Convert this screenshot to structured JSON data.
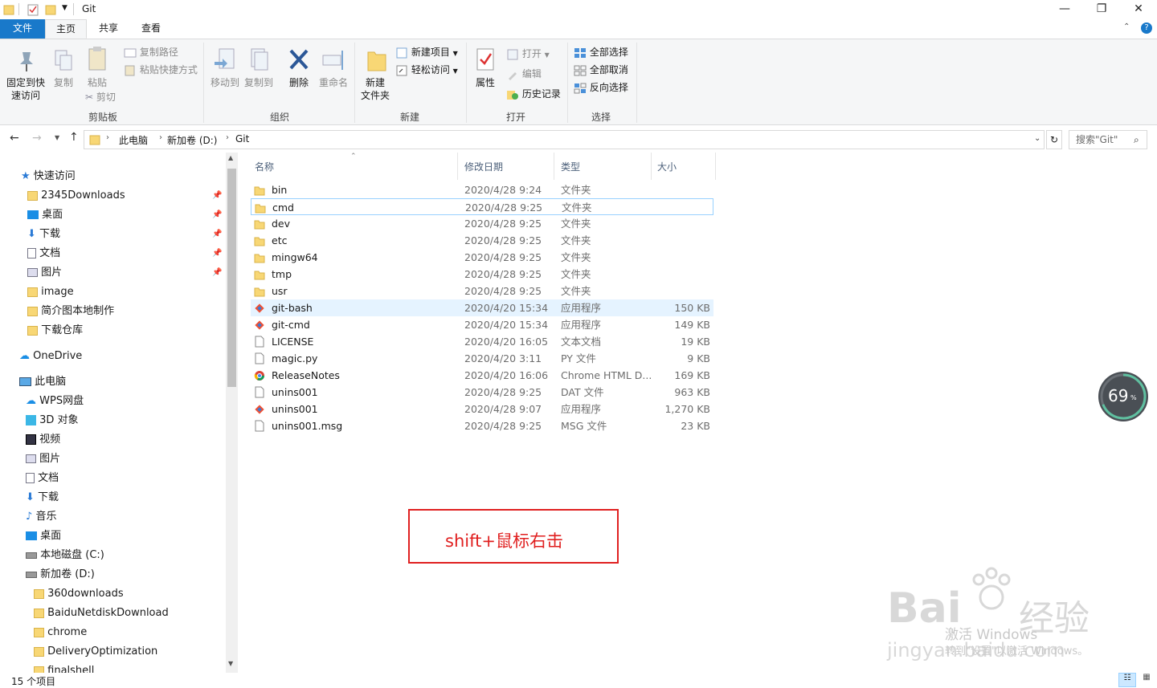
{
  "window": {
    "title": "Git",
    "controls": {
      "minimize": "—",
      "maximize": "❐",
      "close": "✕"
    }
  },
  "ribbon_tabs": [
    "文件",
    "主页",
    "共享",
    "查看"
  ],
  "ribbon": {
    "clipboard": {
      "pin_label_1": "固定到快",
      "pin_label_2": "速访问",
      "copy": "复制",
      "paste": "粘贴",
      "copy_path": "复制路径",
      "paste_shortcut": "粘贴快捷方式",
      "cut": "剪切",
      "group": "剪贴板"
    },
    "organize": {
      "move_to": "移动到",
      "copy_to": "复制到",
      "delete": "删除",
      "rename": "重命名",
      "group": "组织"
    },
    "new": {
      "new_folder_1": "新建",
      "new_folder_2": "文件夹",
      "new_item": "新建项目",
      "easy_access": "轻松访问",
      "group": "新建"
    },
    "open": {
      "properties": "属性",
      "open": "打开",
      "edit": "编辑",
      "history": "历史记录",
      "group": "打开"
    },
    "select": {
      "select_all": "全部选择",
      "select_none": "全部取消",
      "invert": "反向选择",
      "group": "选择"
    }
  },
  "address": {
    "crumbs": [
      "此电脑",
      "新加卷 (D:)",
      "Git"
    ],
    "search_placeholder": "搜索\"Git\""
  },
  "nav": {
    "quick_access": "快速访问",
    "quick_items": [
      "2345Downloads",
      "桌面",
      "下载",
      "文档",
      "图片",
      "image",
      "简介图本地制作",
      "下载仓库"
    ],
    "onedrive": "OneDrive",
    "this_pc": "此电脑",
    "pc_items": [
      "WPS网盘",
      "3D 对象",
      "视频",
      "图片",
      "文档",
      "下载",
      "音乐",
      "桌面",
      "本地磁盘 (C:)",
      "新加卷 (D:)"
    ],
    "d_items": [
      "360downloads",
      "BaiduNetdiskDownload",
      "chrome",
      "DeliveryOptimization",
      "finalshell"
    ]
  },
  "columns": {
    "name": "名称",
    "date": "修改日期",
    "type": "类型",
    "size": "大小"
  },
  "files": [
    {
      "name": "bin",
      "date": "2020/4/28 9:24",
      "type": "文件夹",
      "size": "",
      "icon": "folder-icon"
    },
    {
      "name": "cmd",
      "date": "2020/4/28 9:25",
      "type": "文件夹",
      "size": "",
      "icon": "folder-icon"
    },
    {
      "name": "dev",
      "date": "2020/4/28 9:25",
      "type": "文件夹",
      "size": "",
      "icon": "folder-icon"
    },
    {
      "name": "etc",
      "date": "2020/4/28 9:25",
      "type": "文件夹",
      "size": "",
      "icon": "folder-icon"
    },
    {
      "name": "mingw64",
      "date": "2020/4/28 9:25",
      "type": "文件夹",
      "size": "",
      "icon": "folder-icon"
    },
    {
      "name": "tmp",
      "date": "2020/4/28 9:25",
      "type": "文件夹",
      "size": "",
      "icon": "folder-icon"
    },
    {
      "name": "usr",
      "date": "2020/4/28 9:25",
      "type": "文件夹",
      "size": "",
      "icon": "folder-icon"
    },
    {
      "name": "git-bash",
      "date": "2020/4/20 15:34",
      "type": "应用程序",
      "size": "150 KB",
      "icon": "git-icon"
    },
    {
      "name": "git-cmd",
      "date": "2020/4/20 15:34",
      "type": "应用程序",
      "size": "149 KB",
      "icon": "git-icon"
    },
    {
      "name": "LICENSE",
      "date": "2020/4/20 16:05",
      "type": "文本文档",
      "size": "19 KB",
      "icon": "file-icon"
    },
    {
      "name": "magic.py",
      "date": "2020/4/20 3:11",
      "type": "PY 文件",
      "size": "9 KB",
      "icon": "file-icon"
    },
    {
      "name": "ReleaseNotes",
      "date": "2020/4/20 16:06",
      "type": "Chrome HTML D...",
      "size": "169 KB",
      "icon": "chrome-icon"
    },
    {
      "name": "unins001",
      "date": "2020/4/28 9:25",
      "type": "DAT 文件",
      "size": "963 KB",
      "icon": "file-icon"
    },
    {
      "name": "unins001",
      "date": "2020/4/28 9:07",
      "type": "应用程序",
      "size": "1,270 KB",
      "icon": "git-icon"
    },
    {
      "name": "unins001.msg",
      "date": "2020/4/28 9:25",
      "type": "MSG 文件",
      "size": "23 KB",
      "icon": "file-icon"
    }
  ],
  "status": {
    "count": "15 个项目"
  },
  "annotation": "shift+鼠标右击",
  "gauge": {
    "value": "69",
    "unit": "%"
  },
  "watermark": {
    "brand": "Bai",
    "brand2": "经验",
    "activate": "激活 Windows",
    "url": "jingyan.baidu.com",
    "hint": "转到\"设置\"以激活 Windows。"
  },
  "colors": {
    "accent": "#1979ca",
    "selection": "#e5f3ff",
    "folder": "#f8d775",
    "annotation": "#e02020"
  }
}
